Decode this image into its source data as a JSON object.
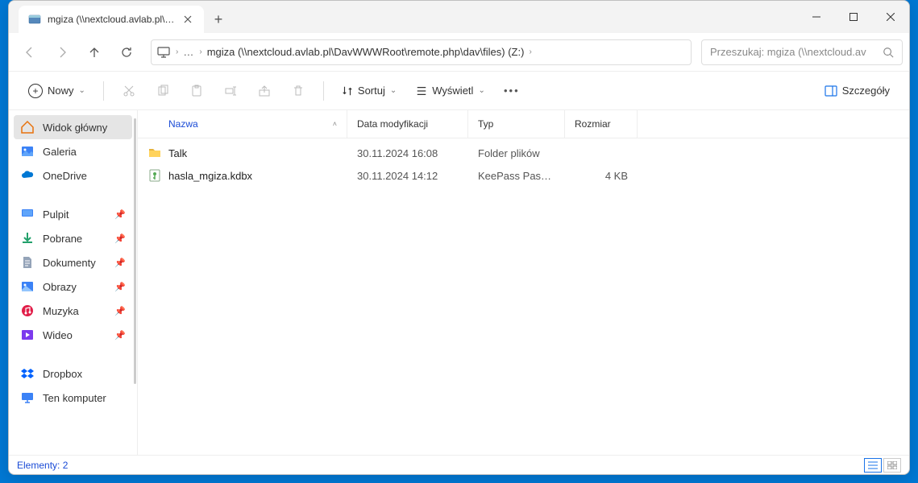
{
  "tab": {
    "title": "mgiza (\\\\nextcloud.avlab.pl\\Da"
  },
  "path": {
    "text": "mgiza (\\\\nextcloud.avlab.pl\\DavWWWRoot\\remote.php\\dav\\files) (Z:)"
  },
  "search": {
    "placeholder": "Przeszukaj: mgiza (\\\\nextcloud.av"
  },
  "toolbar": {
    "new": "Nowy",
    "sort": "Sortuj",
    "view": "Wyświetl",
    "details": "Szczegóły"
  },
  "sidebar": {
    "home": "Widok główny",
    "gallery": "Galeria",
    "onedrive": "OneDrive",
    "desktop": "Pulpit",
    "downloads": "Pobrane",
    "documents": "Dokumenty",
    "pictures": "Obrazy",
    "music": "Muzyka",
    "videos": "Wideo",
    "dropbox": "Dropbox",
    "thispc": "Ten komputer"
  },
  "columns": {
    "name": "Nazwa",
    "date": "Data modyfikacji",
    "type": "Typ",
    "size": "Rozmiar"
  },
  "rows": [
    {
      "name": "Talk",
      "date": "30.11.2024 16:08",
      "type": "Folder plików",
      "size": ""
    },
    {
      "name": "hasla_mgiza.kdbx",
      "date": "30.11.2024 14:12",
      "type": "KeePass Password...",
      "size": "4 KB"
    }
  ],
  "status": {
    "items": "Elementy: 2"
  }
}
